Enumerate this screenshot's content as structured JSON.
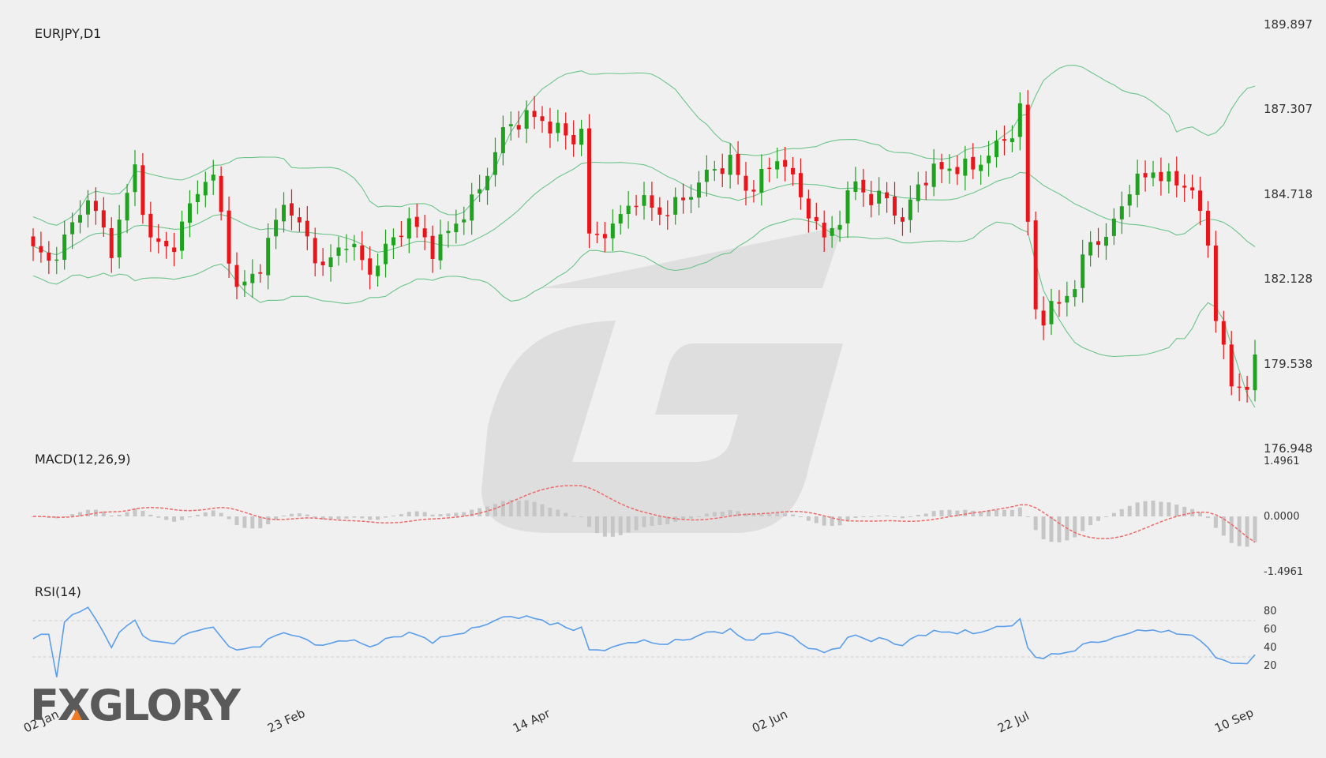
{
  "logo_text": "FXGLORY",
  "panels": {
    "price_label": "EURJPY,D1",
    "macd_label": "MACD(12,26,9)",
    "rsi_label": "RSI(14)"
  },
  "colors": {
    "bull": "#1fa31f",
    "bear": "#e8161b",
    "bands": "#6cc48a",
    "macd_signal": "#ee6a6a",
    "macd_hist": "#c6c6c6",
    "rsi": "#5b9ee9",
    "watermark": "#dcdcdc"
  },
  "chart_data": [
    {
      "type": "candlestick",
      "title": "EURJPY,D1",
      "y_ticks": [
        "189.897",
        "187.307",
        "184.718",
        "182.128",
        "179.538",
        "176.948"
      ],
      "ylim": [
        176.948,
        189.897
      ],
      "x_ticks": [
        "02 Jan",
        "23 Feb",
        "14 Apr",
        "02 Jun",
        "22 Jul",
        "10 Sep"
      ],
      "x_tick_index": [
        0,
        36,
        72,
        107,
        143,
        179
      ],
      "close_anchors": [
        [
          0,
          183.1
        ],
        [
          2,
          182.6
        ],
        [
          4,
          183.3
        ],
        [
          7,
          184.6
        ],
        [
          10,
          183.0
        ],
        [
          13,
          185.5
        ],
        [
          15,
          183.2
        ],
        [
          18,
          183.1
        ],
        [
          21,
          184.9
        ],
        [
          23,
          185.2
        ],
        [
          26,
          181.7
        ],
        [
          29,
          182.5
        ],
        [
          32,
          184.5
        ],
        [
          35,
          183.3
        ],
        [
          37,
          182.4
        ],
        [
          40,
          183.3
        ],
        [
          43,
          182.3
        ],
        [
          45,
          183.0
        ],
        [
          48,
          183.9
        ],
        [
          51,
          183.0
        ],
        [
          54,
          183.8
        ],
        [
          57,
          184.8
        ],
        [
          60,
          186.6
        ],
        [
          63,
          187.1
        ],
        [
          66,
          186.8
        ],
        [
          69,
          186.3
        ],
        [
          70,
          186.8
        ],
        [
          71,
          183.3
        ],
        [
          74,
          183.7
        ],
        [
          77,
          184.6
        ],
        [
          80,
          184.1
        ],
        [
          83,
          184.5
        ],
        [
          86,
          185.3
        ],
        [
          89,
          185.7
        ],
        [
          91,
          184.8
        ],
        [
          93,
          185.2
        ],
        [
          95,
          185.8
        ],
        [
          96,
          185.6
        ],
        [
          98,
          184.6
        ],
        [
          101,
          183.3
        ],
        [
          103,
          184.0
        ],
        [
          105,
          185.1
        ],
        [
          107,
          184.5
        ],
        [
          109,
          184.6
        ],
        [
          111,
          183.8
        ],
        [
          113,
          185.0
        ],
        [
          115,
          185.4
        ],
        [
          117,
          185.5
        ],
        [
          120,
          185.5
        ],
        [
          122,
          185.9
        ],
        [
          125,
          186.6
        ],
        [
          126,
          187.3
        ],
        [
          127,
          183.8
        ],
        [
          128,
          181.2
        ],
        [
          129,
          180.9
        ],
        [
          131,
          181.4
        ],
        [
          133,
          181.9
        ],
        [
          135,
          183.3
        ],
        [
          137,
          183.3
        ],
        [
          140,
          184.9
        ],
        [
          143,
          185.4
        ],
        [
          145,
          185.1
        ],
        [
          147,
          185.0
        ],
        [
          148,
          184.8
        ],
        [
          150,
          183.2
        ],
        [
          151,
          181.0
        ],
        [
          152,
          179.9
        ],
        [
          153,
          178.8
        ],
        [
          155,
          178.9
        ],
        [
          156,
          179.5
        ]
      ],
      "note_bands": "Bollinger Bands (upper, middle, lower) drawn around price",
      "note_macd": {
        "label": "MACD(12,26,9)",
        "y_ticks": [
          "1.4961",
          "0.0000",
          "-1.4961"
        ]
      },
      "note_rsi": {
        "label": "RSI(14)",
        "y_ticks": [
          "80",
          "60",
          "40",
          "20"
        ],
        "levels": [
          70,
          30
        ]
      }
    }
  ]
}
